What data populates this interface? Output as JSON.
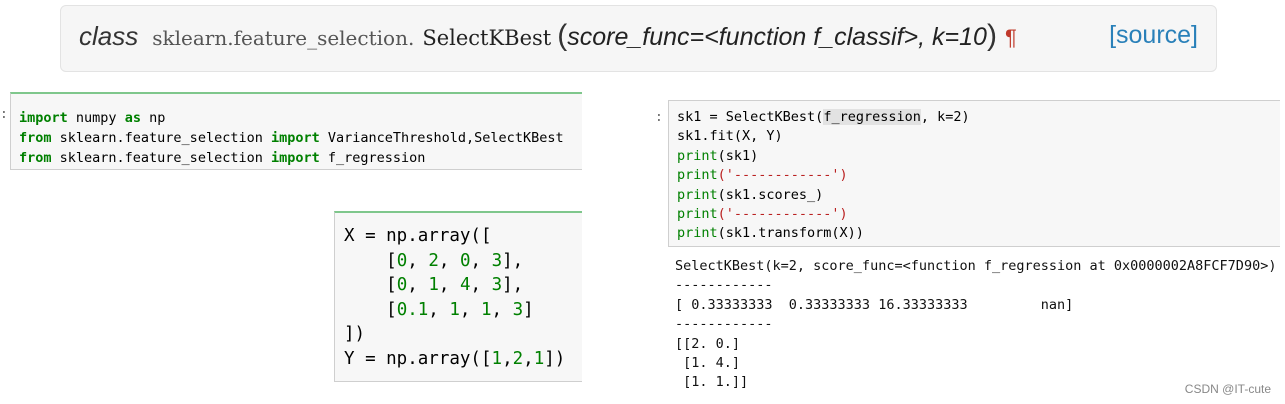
{
  "signature": {
    "class_word": "class",
    "module": "sklearn.feature_selection.",
    "name": "SelectKBest",
    "open_paren": "(",
    "params": "score_func=<function f_classif>, k=10",
    "close_paren": ")",
    "pilcrow": "¶",
    "source_link": "[source]"
  },
  "import_cell": {
    "prompt": ":",
    "line1": {
      "kw1": "import",
      "mod": " numpy ",
      "kw2": "as",
      "alias": " np"
    },
    "line2": {
      "kw1": "from",
      "mod": " sklearn.feature_selection ",
      "kw2": "import",
      "rest": " VarianceThreshold,SelectKBest"
    },
    "line3": {
      "kw1": "from",
      "mod": " sklearn.feature_selection ",
      "kw2": "import",
      "rest": " f_regression"
    }
  },
  "array_cell": {
    "line1": "X = np.array([",
    "row1": [
      "0",
      "2",
      "0",
      "3"
    ],
    "row2": [
      "0",
      "1",
      "4",
      "3"
    ],
    "row3": [
      "0.1",
      "1",
      "1",
      "3"
    ],
    "line5": "])",
    "line6_prefix": "Y = np.array([",
    "y_values": [
      "1",
      "2",
      "1"
    ],
    "line6_suffix": "])"
  },
  "right_cell": {
    "prompt": ":",
    "l1_a": "sk1 = SelectKBest(",
    "l1_hl": "f_regression",
    "l1_b": ", k=2)",
    "l2": "sk1.fit(X, Y)",
    "l3_fn": "print",
    "l3_arg": "(sk1)",
    "l4_fn": "print",
    "l4_str": "('------------')",
    "l5_fn": "print",
    "l5_arg": "(sk1.scores_)",
    "l6_fn": "print",
    "l6_str": "('------------')",
    "l7_fn": "print",
    "l7_arg": "(sk1.transform(X))"
  },
  "output": {
    "l1": "SelectKBest(k=2, score_func=<function f_regression at 0x0000002A8FCF7D90>)",
    "l2": "------------",
    "l3": "[ 0.33333333  0.33333333 16.33333333         nan]",
    "l4": "------------",
    "l5": "[[2. 0.]",
    "l6": " [1. 4.]",
    "l7": " [1. 1.]]"
  },
  "watermark": "CSDN @IT-cute"
}
